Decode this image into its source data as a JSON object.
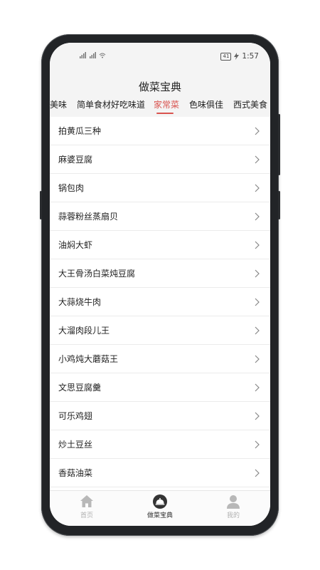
{
  "status_bar": {
    "signal_text": "ᵢ⁰ᵢ ᵢ⁰ᵢ",
    "battery": "41",
    "time": "1:57"
  },
  "header": {
    "title": "做菜宝典"
  },
  "tabs": [
    {
      "label": "美味"
    },
    {
      "label": "简单食材好吃味道"
    },
    {
      "label": "家常菜",
      "active": true
    },
    {
      "label": "色味俱佳"
    },
    {
      "label": "西式美食"
    }
  ],
  "recipes": [
    {
      "label": "拍黄瓜三种"
    },
    {
      "label": "麻婆豆腐"
    },
    {
      "label": "锅包肉"
    },
    {
      "label": "蒜蓉粉丝蒸扇贝"
    },
    {
      "label": "油焖大虾"
    },
    {
      "label": "大王骨汤白菜炖豆腐"
    },
    {
      "label": "大蒜烧牛肉"
    },
    {
      "label": "大溜肉段儿王"
    },
    {
      "label": "小鸡炖大蘑菇王"
    },
    {
      "label": "文思豆腐羹"
    },
    {
      "label": "可乐鸡翅"
    },
    {
      "label": "炒土豆丝"
    },
    {
      "label": "香菇油菜"
    }
  ],
  "bottom_nav": [
    {
      "label": "首页",
      "icon": "home-icon"
    },
    {
      "label": "做菜宝典",
      "icon": "cloche-icon",
      "active": true
    },
    {
      "label": "我的",
      "icon": "person-icon"
    }
  ],
  "colors": {
    "accent": "#d9534f",
    "inactive_nav": "#b0b0b0"
  }
}
